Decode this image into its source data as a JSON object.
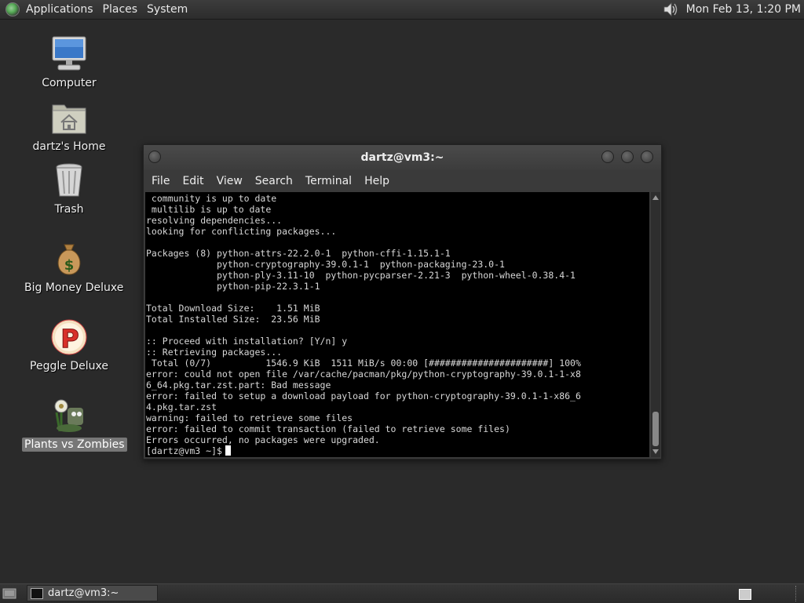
{
  "top_panel": {
    "menus": [
      "Applications",
      "Places",
      "System"
    ],
    "clock": "Mon Feb 13,  1:20 PM"
  },
  "desktop_icons": [
    {
      "label": "Computer",
      "icon": "computer-icon"
    },
    {
      "label": "dartz's Home",
      "icon": "home-folder-icon"
    },
    {
      "label": "Trash",
      "icon": "trash-icon"
    },
    {
      "label": "Big Money Deluxe",
      "icon": "money-bag-icon"
    },
    {
      "label": "Peggle Deluxe",
      "icon": "peggle-icon"
    },
    {
      "label": "Plants vs Zombies",
      "icon": "plants-vs-zombies-icon"
    }
  ],
  "terminal": {
    "title": "dartz@vm3:~",
    "menus": [
      "File",
      "Edit",
      "View",
      "Search",
      "Terminal",
      "Help"
    ],
    "output": " community is up to date\n multilib is up to date\nresolving dependencies...\nlooking for conflicting packages...\n\nPackages (8) python-attrs-22.2.0-1  python-cffi-1.15.1-1\n             python-cryptography-39.0.1-1  python-packaging-23.0-1\n             python-ply-3.11-10  python-pycparser-2.21-3  python-wheel-0.38.4-1\n             python-pip-22.3.1-1\n\nTotal Download Size:    1.51 MiB\nTotal Installed Size:  23.56 MiB\n\n:: Proceed with installation? [Y/n] y\n:: Retrieving packages...\n Total (0/7)          1546.9 KiB  1511 MiB/s 00:00 [######################] 100%\nerror: could not open file /var/cache/pacman/pkg/python-cryptography-39.0.1-1-x8\n6_64.pkg.tar.zst.part: Bad message\nerror: failed to setup a download payload for python-cryptography-39.0.1-1-x86_6\n4.pkg.tar.zst\nwarning: failed to retrieve some files\nerror: failed to commit transaction (failed to retrieve some files)\nErrors occurred, no packages were upgraded.",
    "prompt": "[dartz@vm3 ~]$"
  },
  "taskbar": {
    "window_label": "dartz@vm3:~"
  }
}
